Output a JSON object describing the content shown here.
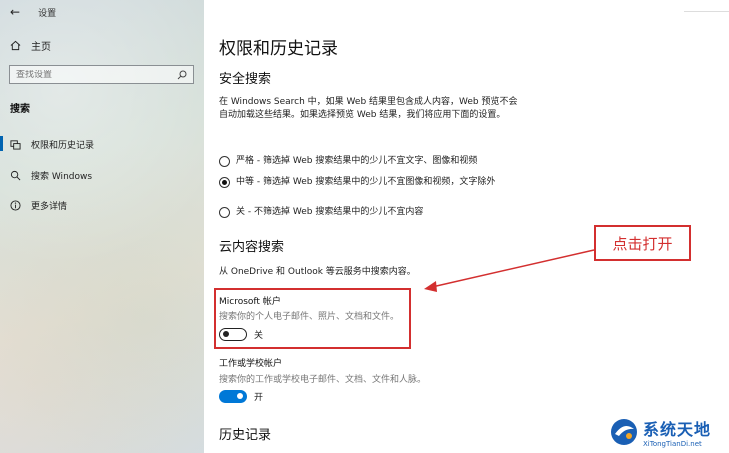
{
  "window": {
    "title": "设置"
  },
  "sidebar": {
    "home_label": "主页",
    "search_placeholder": "查找设置",
    "section_label": "搜索",
    "items": [
      {
        "label": "权限和历史记录",
        "icon": "permissions-icon",
        "active": true
      },
      {
        "label": "搜索 Windows",
        "icon": "search-icon",
        "active": false
      },
      {
        "label": "更多详情",
        "icon": "info-icon",
        "active": false
      }
    ]
  },
  "main": {
    "title": "权限和历史记录",
    "safe_search": {
      "heading": "安全搜索",
      "description": "在 Windows Search 中，如果 Web 结果里包含成人内容，Web 预览不会自动加载这些结果。如果选择预览 Web 结果，我们将应用下面的设置。",
      "options": [
        {
          "label": "严格 - 筛选掉 Web 搜索结果中的少儿不宜文字、图像和视频",
          "checked": false
        },
        {
          "label": "中等 - 筛选掉 Web 搜索结果中的少儿不宜图像和视频，文字除外",
          "checked": true
        },
        {
          "label": "关 - 不筛选掉 Web 搜索结果中的少儿不宜内容",
          "checked": false
        }
      ]
    },
    "cloud_search": {
      "heading": "云内容搜索",
      "description": "从 OneDrive 和 Outlook 等云服务中搜索内容。",
      "microsoft_account": {
        "label": "Microsoft 帐户",
        "sublabel": "搜索你的个人电子邮件、照片、文档和文件。",
        "toggle_state": "关",
        "on": false
      },
      "work_account": {
        "label": "工作或学校帐户",
        "sublabel": "搜索你的工作或学校电子邮件、文档、文件和人脉。",
        "toggle_state": "开",
        "on": true
      }
    },
    "history": {
      "heading": "历史记录"
    }
  },
  "annotation": {
    "text": "点击打开",
    "color": "#d32f2f"
  },
  "watermark": {
    "main": "系统天地",
    "sub": "XiTongTianDi.net"
  },
  "colors": {
    "accent": "#0078d7",
    "annotation": "#d32f2f"
  }
}
